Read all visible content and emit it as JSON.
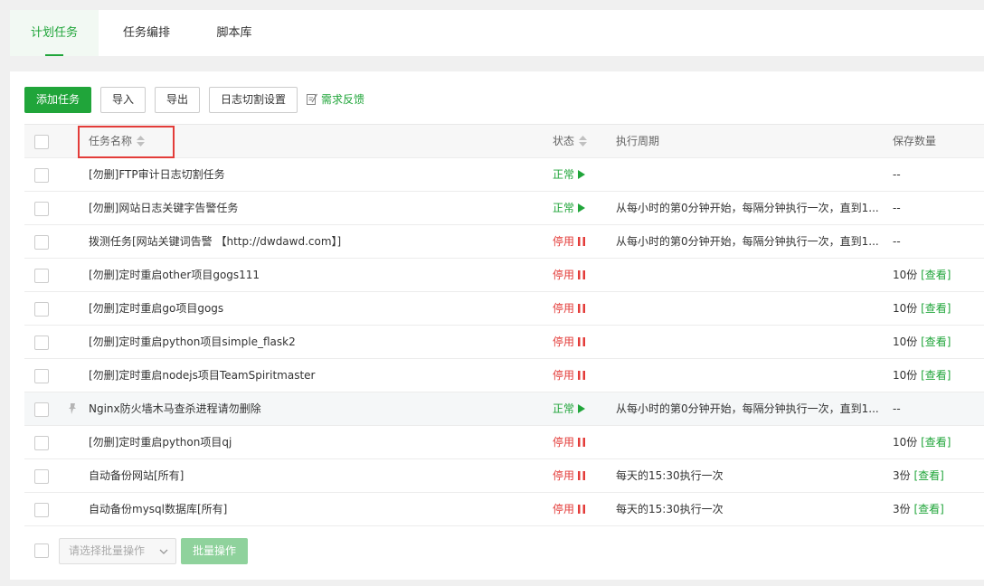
{
  "tabs": [
    {
      "label": "计划任务",
      "active": true
    },
    {
      "label": "任务编排",
      "active": false
    },
    {
      "label": "脚本库",
      "active": false
    }
  ],
  "toolbar": {
    "add_label": "添加任务",
    "import_label": "导入",
    "export_label": "导出",
    "log_cut_label": "日志切割设置",
    "feedback_label": "需求反馈"
  },
  "columns": {
    "name": "任务名称",
    "status": "状态",
    "cycle": "执行周期",
    "save": "保存数量"
  },
  "rows": [
    {
      "name": "[勿删]FTP审计日志切割任务",
      "status": "正常",
      "cycle": "",
      "save_count": "--",
      "view": ""
    },
    {
      "name": "[勿删]网站日志关键字告警任务",
      "status": "正常",
      "cycle": "从每小时的第0分钟开始，每隔分钟执行一次，直到1...",
      "save_count": "--",
      "view": ""
    },
    {
      "name": "拨测任务[网站关键词告警 【http://dwdawd.com】]",
      "status": "停用",
      "cycle": "从每小时的第0分钟开始，每隔分钟执行一次，直到1...",
      "save_count": "--",
      "view": ""
    },
    {
      "name": "[勿删]定时重启other项目gogs111",
      "status": "停用",
      "cycle": "",
      "save_count": "10份",
      "view": "[查看]"
    },
    {
      "name": "[勿删]定时重启go项目gogs",
      "status": "停用",
      "cycle": "",
      "save_count": "10份",
      "view": "[查看]"
    },
    {
      "name": "[勿删]定时重启python项目simple_flask2",
      "status": "停用",
      "cycle": "",
      "save_count": "10份",
      "view": "[查看]"
    },
    {
      "name": "[勿删]定时重启nodejs项目TeamSpiritmaster",
      "status": "停用",
      "cycle": "",
      "save_count": "10份",
      "view": "[查看]"
    },
    {
      "name": "Nginx防火墙木马查杀进程请勿删除",
      "status": "正常",
      "cycle": "从每小时的第0分钟开始，每隔分钟执行一次，直到1...",
      "save_count": "--",
      "view": "",
      "pinned": true
    },
    {
      "name": "[勿删]定时重启python项目qj",
      "status": "停用",
      "cycle": "",
      "save_count": "10份",
      "view": "[查看]"
    },
    {
      "name": "自动备份网站[所有]",
      "status": "停用",
      "cycle": "每天的15:30执行一次",
      "save_count": "3份",
      "view": "[查看]"
    },
    {
      "name": "自动备份mysql数据库[所有]",
      "status": "停用",
      "cycle": "每天的15:30执行一次",
      "save_count": "3份",
      "view": "[查看]"
    }
  ],
  "footer": {
    "batch_placeholder": "请选择批量操作",
    "batch_button": "批量操作"
  },
  "colors": {
    "accent": "#20a53a",
    "danger": "#e33c39"
  }
}
